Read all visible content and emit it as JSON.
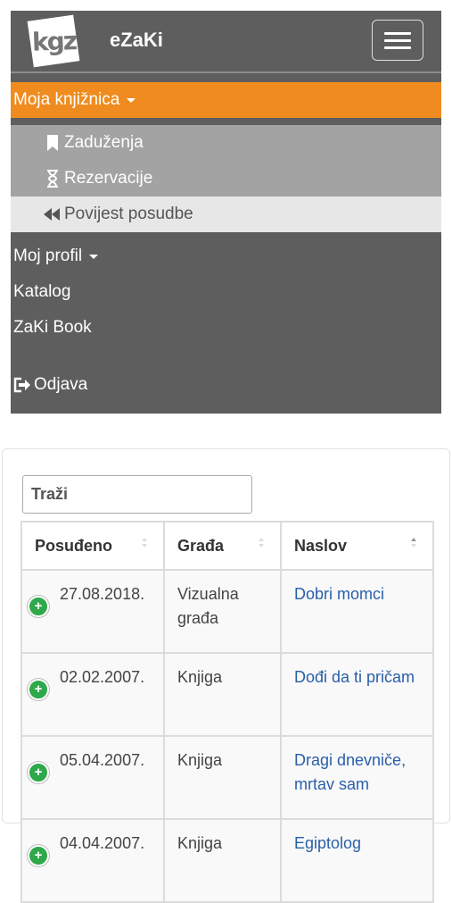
{
  "app": {
    "brand": "eZaKi",
    "logo_text": "kgz"
  },
  "menu": {
    "moja_knjiznica": "Moja knjižnica",
    "submenu": [
      {
        "label": "Zaduženja",
        "icon": "bookmark-icon"
      },
      {
        "label": "Rezervacije",
        "icon": "hourglass-icon"
      },
      {
        "label": "Povijest posudbe",
        "icon": "backward-icon"
      }
    ],
    "moj_profil": "Moj profil",
    "katalog": "Katalog",
    "zaki_book": "ZaKi Book",
    "odjava": "Odjava"
  },
  "search": {
    "placeholder": "Traži"
  },
  "table": {
    "headers": [
      "Posuđeno",
      "Građa",
      "Naslov"
    ],
    "rows": [
      {
        "posudeno": "27.08.2018.",
        "grada": "Vizualna građa",
        "naslov": "Dobri momci"
      },
      {
        "posudeno": "02.02.2007.",
        "grada": "Knjiga",
        "naslov": "Dođi da ti pričam"
      },
      {
        "posudeno": "05.04.2007.",
        "grada": "Knjiga",
        "naslov": "Dragi dnevniče, mrtav sam"
      },
      {
        "posudeno": "04.04.2007.",
        "grada": "Knjiga",
        "naslov": "Egiptolog"
      }
    ]
  },
  "colors": {
    "navbar": "#5e5e5e",
    "accent": "#f08c1f",
    "submenu": "#a3a3a3",
    "active_sub": "#e7e7e7",
    "link": "#2a5fa8",
    "expand": "#2ea84a"
  }
}
